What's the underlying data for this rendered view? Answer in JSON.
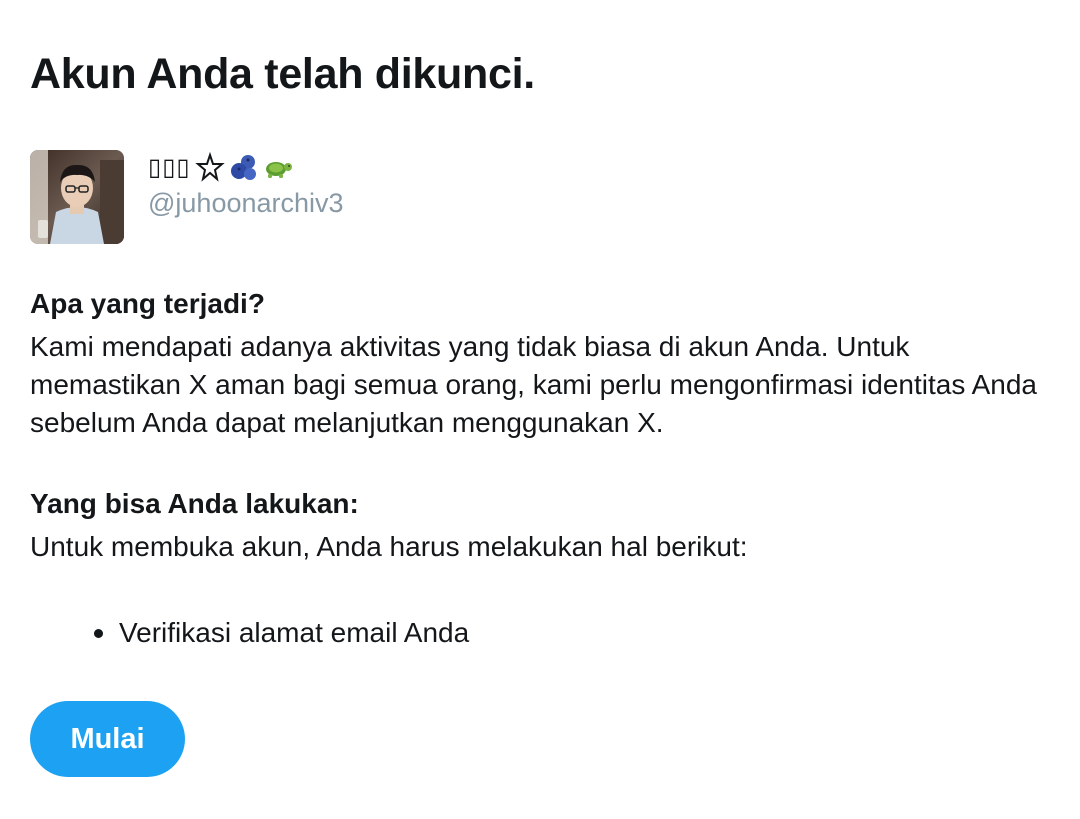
{
  "page": {
    "title": "Akun Anda telah dikunci."
  },
  "account": {
    "display_name": "▯▯▯",
    "emoji_icons": [
      "pentagram-icon",
      "blueberries-icon",
      "turtle-icon"
    ],
    "handle": "@juhoonarchiv3"
  },
  "what_happened": {
    "heading": "Apa yang terjadi?",
    "text": "Kami mendapati adanya aktivitas yang tidak biasa di akun Anda. Untuk memastikan X aman bagi semua orang, kami perlu mengonfirmasi identitas Anda sebelum Anda dapat melanjutkan menggunakan X."
  },
  "what_you_can_do": {
    "heading": "Yang bisa Anda lakukan:",
    "text": "Untuk membuka akun, Anda harus melakukan hal berikut:",
    "steps": [
      "Verifikasi alamat email Anda"
    ]
  },
  "actions": {
    "start_label": "Mulai"
  },
  "colors": {
    "accent": "#1da1f2",
    "text": "#14171a",
    "muted": "#8899a6",
    "background": "#ffffff"
  }
}
